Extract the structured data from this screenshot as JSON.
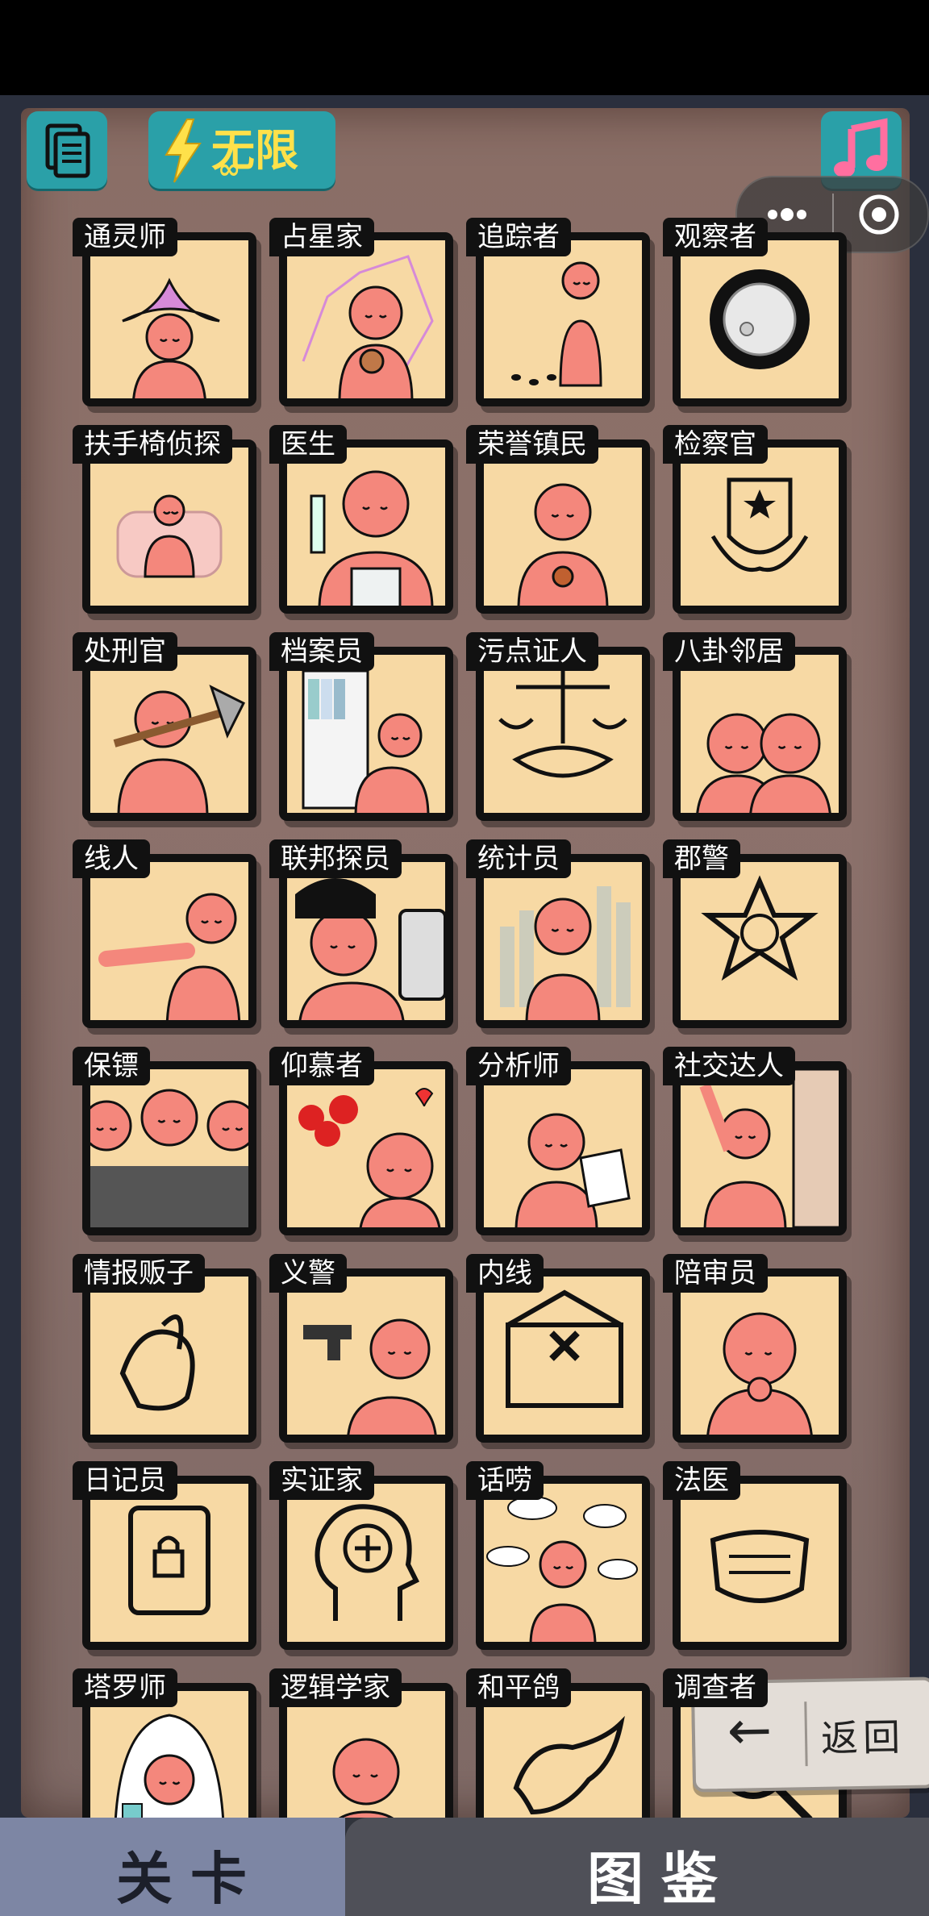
{
  "toolbar": {
    "energy_label": "无限",
    "energy_infinite": "∞"
  },
  "colors": {
    "card_bg": "#f7d9a4",
    "figure": "#f4877c",
    "teal_button": "#2aa0a8",
    "energy_yellow": "#ffe14a"
  },
  "cards": [
    {
      "label": "通灵师",
      "icon": "witch-hat-icon"
    },
    {
      "label": "占星家",
      "icon": "constellation-icon"
    },
    {
      "label": "追踪者",
      "icon": "footprints-icon"
    },
    {
      "label": "观察者",
      "icon": "eye-icon"
    },
    {
      "label": "扶手椅侦探",
      "icon": "armchair-icon"
    },
    {
      "label": "医生",
      "icon": "syringe-icon"
    },
    {
      "label": "荣誉镇民",
      "icon": "medal-icon"
    },
    {
      "label": "检察官",
      "icon": "justice-emblem-icon"
    },
    {
      "label": "处刑官",
      "icon": "axe-icon"
    },
    {
      "label": "档案员",
      "icon": "bookshelf-icon"
    },
    {
      "label": "污点证人",
      "icon": "scales-handshake-icon"
    },
    {
      "label": "八卦邻居",
      "icon": "whisper-icon"
    },
    {
      "label": "线人",
      "icon": "pointing-icon"
    },
    {
      "label": "联邦探员",
      "icon": "fbi-badge-icon"
    },
    {
      "label": "统计员",
      "icon": "bar-chart-icon"
    },
    {
      "label": "郡警",
      "icon": "sheriff-star-icon"
    },
    {
      "label": "保镖",
      "icon": "bodyguards-icon"
    },
    {
      "label": "仰慕者",
      "icon": "roses-icon"
    },
    {
      "label": "分析师",
      "icon": "document-icon"
    },
    {
      "label": "社交达人",
      "icon": "cheering-icon"
    },
    {
      "label": "情报贩子",
      "icon": "hand-whisper-icon"
    },
    {
      "label": "义警",
      "icon": "pistol-icon"
    },
    {
      "label": "内线",
      "icon": "envelope-x-icon"
    },
    {
      "label": "陪审员",
      "icon": "praying-icon"
    },
    {
      "label": "日记员",
      "icon": "locked-diary-icon"
    },
    {
      "label": "实证家",
      "icon": "head-plus-icon"
    },
    {
      "label": "话唠",
      "icon": "speech-bubbles-icon"
    },
    {
      "label": "法医",
      "icon": "mask-icon"
    },
    {
      "label": "塔罗师",
      "icon": "tarot-cards-icon"
    },
    {
      "label": "逻辑学家",
      "icon": "formula-icon"
    },
    {
      "label": "和平鸽",
      "icon": "dove-icon"
    },
    {
      "label": "调查者",
      "icon": "magnifier-icon"
    }
  ],
  "back_button": {
    "arrow": "←",
    "label": "返回"
  },
  "tabs": [
    {
      "label": "关卡",
      "active": true
    },
    {
      "label": "图鉴",
      "active": false
    }
  ]
}
